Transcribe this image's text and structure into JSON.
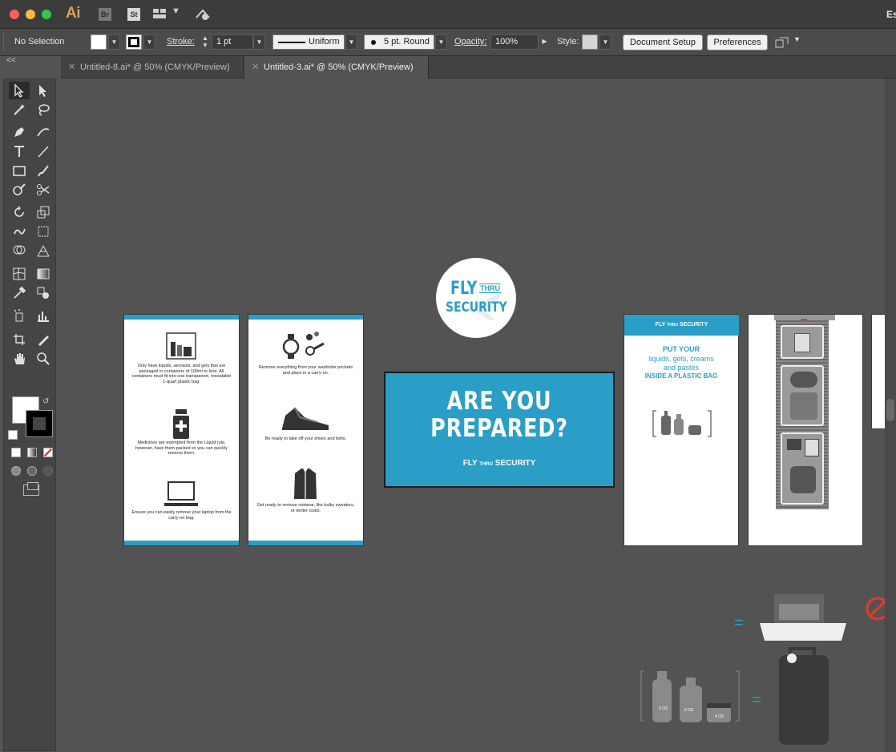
{
  "app": {
    "logo_text": "Ai",
    "bridge_label": "Br",
    "stock_label": "St",
    "search_partial": "Es"
  },
  "control_bar": {
    "selection_label": "No Selection",
    "stroke_label": "Stroke:",
    "stroke_weight": "1 pt",
    "stroke_profile": "Uniform",
    "brush_label": "5 pt. Round",
    "opacity_label": "Opacity:",
    "opacity_value": "100%",
    "style_label": "Style:",
    "document_setup": "Document Setup",
    "preferences": "Preferences"
  },
  "toolbar": {
    "collapse_label": "<<"
  },
  "tabs": [
    {
      "label": "Untitled-8.ai* @ 50% (CMYK/Preview)",
      "active": false
    },
    {
      "label": "Untitled-3.ai* @ 50% (CMYK/Preview)",
      "active": true
    }
  ],
  "artwork": {
    "panel1": {
      "text1": "Only have liquids, aerosols, and gels that are packaged in containers of 100ml or less. All containers must fit into one transparent, resealable 1-quart plastic bag.",
      "text2": "Medicines are exempted from the Liquid rule, however, have them packed so you can quickly remove them.",
      "text3": "Ensure you can easily remove your laptop from the carry-on bag."
    },
    "panel2": {
      "text1": "Remove everything from your wardrobe pockets and place in a carry-on.",
      "text2": "Be ready to take off your shoes and belts.",
      "text3": "Get ready to remove outwear, like bulky sweaters, or winter coats."
    },
    "banner": {
      "line1": "ARE YOU",
      "line2": "PREPARED?",
      "brand_fly": "FLY",
      "brand_thru": "THRU",
      "brand_security": "SECURITY"
    },
    "logo": {
      "fly": "FLY",
      "thru": "THRU",
      "security": "SECURITY"
    },
    "panel3": {
      "header_fly": "FLY",
      "header_thru": "THRU",
      "header_security": "SECURITY",
      "line1": "PUT YOUR",
      "line2": "liquids, gels, creams",
      "line3": "and pastes",
      "line4": "INSIDE A PLASTIC BAG"
    },
    "bottom": {
      "bottle1": "9 OZ",
      "bottle2": "6 OZ",
      "jar": "4 OZ"
    }
  },
  "colors": {
    "brand_blue": "#2a9ec6",
    "canvas": "#535353"
  }
}
